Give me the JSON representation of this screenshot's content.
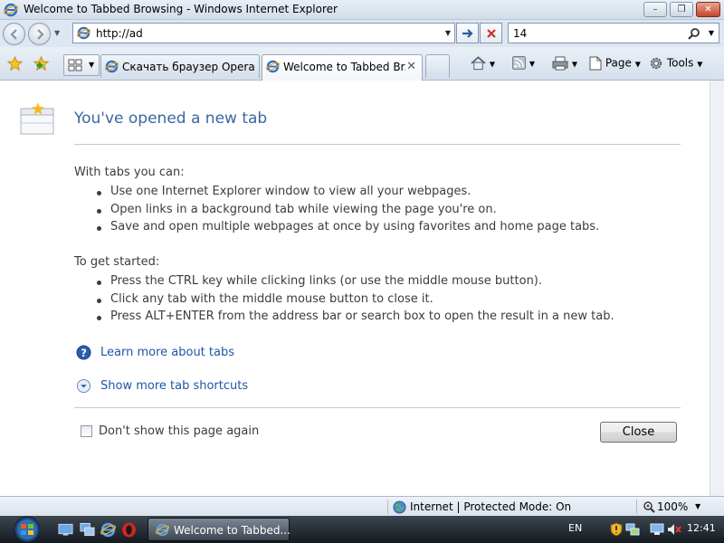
{
  "window": {
    "title": "Welcome to Tabbed Browsing - Windows Internet Explorer",
    "min_label": "–",
    "max_label": "❐",
    "close_label": "✕"
  },
  "nav": {
    "address_value": "http://ad",
    "search_value": "14"
  },
  "tabs": [
    {
      "label": "Скачать браузер Opera д...",
      "active": false
    },
    {
      "label": "Welcome to Tabbed Br...",
      "active": true
    }
  ],
  "commands": {
    "page_label": "Page",
    "tools_label": "Tools"
  },
  "content": {
    "heading": "You've opened a new tab",
    "intro": "With tabs you can:",
    "intro_items": [
      "Use one Internet Explorer window to view all your webpages.",
      "Open links in a background tab while viewing the page you're on.",
      "Save and open multiple webpages at once by using favorites and home page tabs."
    ],
    "started": "To get started:",
    "started_items": [
      "Press the CTRL key while clicking links (or use the middle mouse button).",
      "Click any tab with the middle mouse button to close it.",
      "Press ALT+ENTER from the address bar or search box to open the result in a new tab."
    ],
    "link_learn": "Learn more about tabs",
    "link_shortcuts": "Show more tab shortcuts",
    "checkbox_label": "Don't show this page again",
    "checkbox_checked": false,
    "close_button": "Close"
  },
  "status": {
    "zone": "Internet | Protected Mode: On",
    "zoom": "100%"
  },
  "taskbar": {
    "task_label": "Welcome to Tabbed...",
    "language": "EN",
    "clock": "12:41"
  },
  "colors": {
    "heading": "#3a66a0",
    "link": "#1f56a6",
    "text": "#3c3c3c"
  },
  "icons": [
    "ie-icon",
    "back-icon",
    "forward-icon",
    "go-icon",
    "stop-icon",
    "search-icon",
    "favorites-star-icon",
    "add-favorite-icon",
    "quick-tabs-icon",
    "home-icon",
    "feeds-icon",
    "print-icon",
    "page-icon",
    "tools-gear-icon",
    "new-tab-icon",
    "help-icon",
    "expand-icon",
    "globe-icon",
    "zoom-icon",
    "windows-orb-icon",
    "show-desktop-icon",
    "switch-windows-icon",
    "opera-icon",
    "shield-icon",
    "network-icon",
    "volume-muted-icon"
  ]
}
